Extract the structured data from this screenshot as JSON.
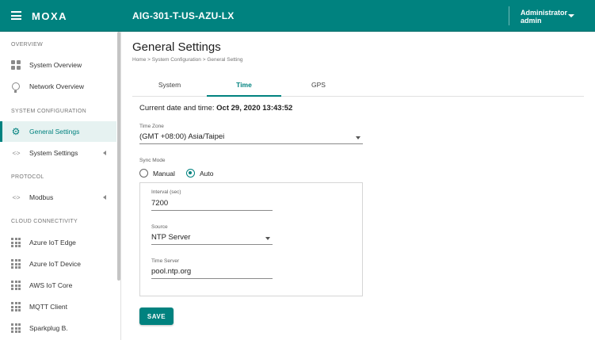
{
  "header": {
    "logo": "MOXA",
    "device_name": "AIG-301-T-US-AZU-LX",
    "user_role": "Administrator",
    "user_name": "admin"
  },
  "sidebar": {
    "sections": [
      {
        "title": "OVERVIEW",
        "items": [
          {
            "label": "System Overview",
            "icon": "dashboard-icon"
          },
          {
            "label": "Network Overview",
            "icon": "network-globe-icon"
          }
        ]
      },
      {
        "title": "SYSTEM CONFIGURATION",
        "items": [
          {
            "label": "General Settings",
            "icon": "gear-icon",
            "active": true
          },
          {
            "label": "System Settings",
            "icon": "code-icon",
            "expandable": true
          }
        ]
      },
      {
        "title": "PROTOCOL",
        "items": [
          {
            "label": "Modbus",
            "icon": "code-icon",
            "expandable": true
          }
        ]
      },
      {
        "title": "CLOUD CONNECTIVITY",
        "items": [
          {
            "label": "Azure IoT Edge",
            "icon": "apps-icon"
          },
          {
            "label": "Azure IoT Device",
            "icon": "apps-icon"
          },
          {
            "label": "AWS IoT Core",
            "icon": "apps-icon"
          },
          {
            "label": "MQTT Client",
            "icon": "apps-icon"
          },
          {
            "label": "Sparkplug B.",
            "icon": "apps-icon"
          }
        ]
      }
    ]
  },
  "main": {
    "title": "General Settings",
    "breadcrumb": [
      "Home",
      "System Configuration",
      "General Setting"
    ],
    "tabs": [
      {
        "label": "System",
        "active": false
      },
      {
        "label": "Time",
        "active": true
      },
      {
        "label": "GPS",
        "active": false
      }
    ],
    "current_datetime_label": "Current date and time:",
    "current_datetime_value": "Oct 29, 2020 13:43:52",
    "time_zone": {
      "label": "Time Zone",
      "value": "(GMT +08:00) Asia/Taipei"
    },
    "sync_mode": {
      "label": "Sync Mode",
      "options": [
        "Manual",
        "Auto"
      ],
      "selected": "Auto"
    },
    "interval": {
      "label": "Interval (sec)",
      "value": "7200"
    },
    "source": {
      "label": "Source",
      "value": "NTP Server"
    },
    "time_server": {
      "label": "Time Server",
      "value": "pool.ntp.org"
    },
    "save_label": "SAVE"
  },
  "colors": {
    "accent": "#00827f",
    "active_bg": "#e6f2f1"
  }
}
